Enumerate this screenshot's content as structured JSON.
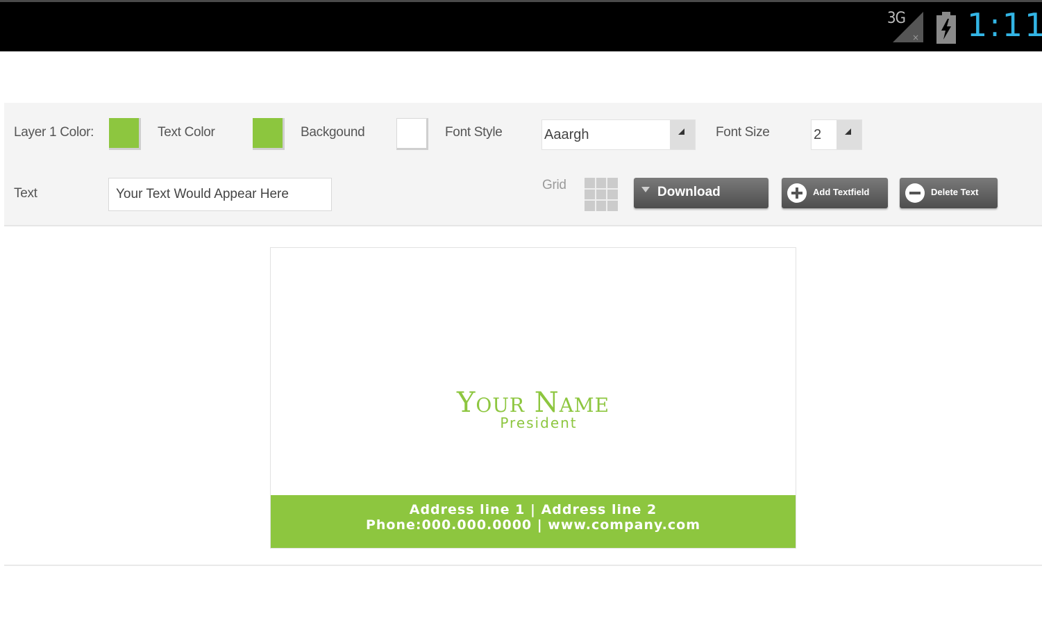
{
  "status_bar": {
    "network": "3G",
    "time": "1:11",
    "time_color": "#33b5e5"
  },
  "toolbar": {
    "layer1_color_label": "Layer 1 Color:",
    "layer1_color": "#8dc63f",
    "text_color_label": "Text Color",
    "text_color": "#8cc63e",
    "background_label": "Backgound",
    "background_color": "#ffffff",
    "font_style_label": "Font Style",
    "font_style_value": "Aaargh",
    "font_size_label": "Font Size",
    "font_size_value": "2",
    "text_label": "Text",
    "text_value": "Your Text Would Appear Here",
    "grid_label": "Grid",
    "download_label": "Download",
    "add_textfield_label": "Add Textfield",
    "delete_text_label": "Delete Text"
  },
  "card": {
    "name": "Your Name",
    "title": "President",
    "address": "Address line 1 | Address line 2",
    "contact": "Phone:000.000.0000 | www.company.com",
    "accent_color": "#8dc63f"
  }
}
